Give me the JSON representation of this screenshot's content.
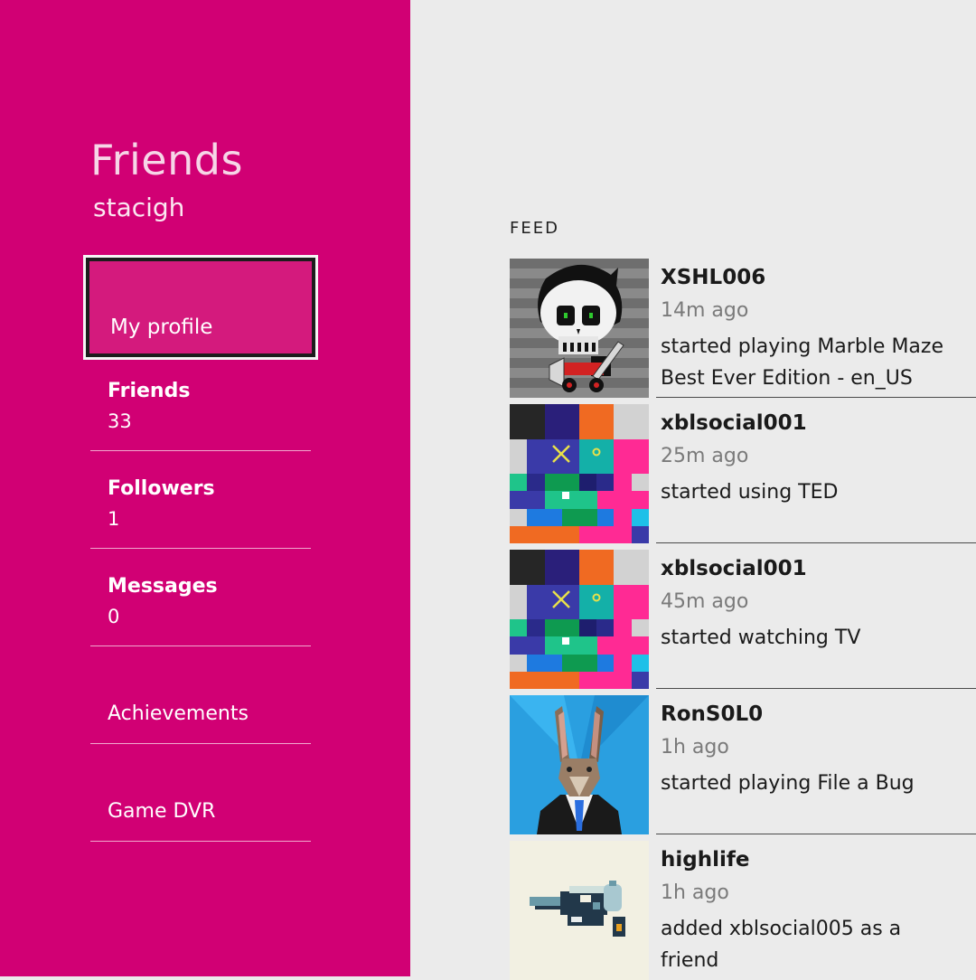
{
  "sidebar": {
    "title": "Friends",
    "user": "stacigh",
    "selected_label": "My profile",
    "items": [
      {
        "label": "Friends",
        "count": "33"
      },
      {
        "label": "Followers",
        "count": "1"
      },
      {
        "label": "Messages",
        "count": "0"
      },
      {
        "label": "Achievements"
      },
      {
        "label": "Game DVR"
      }
    ]
  },
  "feed": {
    "label": "FEED",
    "items": [
      {
        "name": "XSHL006",
        "time": "14m ago",
        "text": "started playing Marble Maze Best Ever Edition - en_US",
        "avatar": "reaper-skull-icon"
      },
      {
        "name": "xblsocial001",
        "time": "25m ago",
        "text": "started using TED",
        "avatar": "pixel-mosaic-icon"
      },
      {
        "name": "xblsocial001",
        "time": "45m ago",
        "text": "started watching TV",
        "avatar": "pixel-mosaic-icon"
      },
      {
        "name": "RonS0L0",
        "time": "1h ago",
        "text": "started playing File a Bug",
        "avatar": "rabbit-in-suit-icon"
      },
      {
        "name": "highlife",
        "time": "1h ago",
        "text": "added xblsocial005 as a friend",
        "avatar": "water-gun-icon"
      }
    ]
  },
  "colors": {
    "accent": "#d10074",
    "background": "#ebebeb"
  }
}
